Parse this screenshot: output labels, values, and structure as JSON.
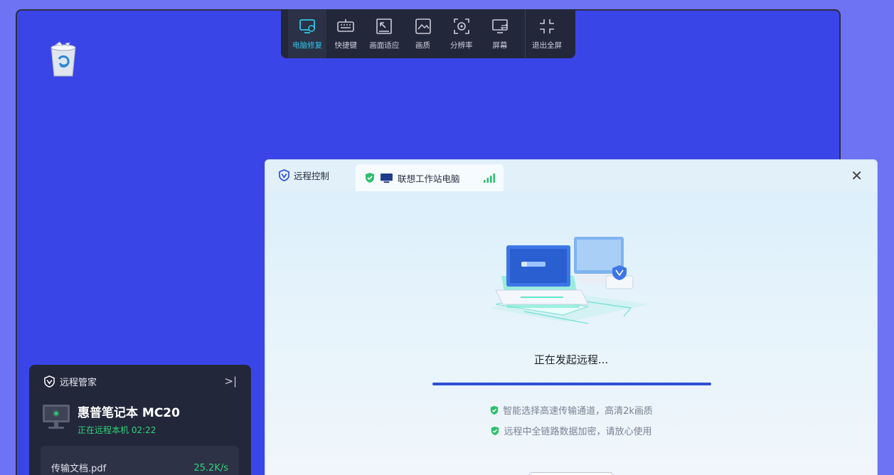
{
  "toolbar": {
    "items": [
      {
        "label": "电脑修复",
        "icon": "monitor-repair-icon",
        "active": true
      },
      {
        "label": "快捷键",
        "icon": "keyboard-icon"
      },
      {
        "label": "画面适应",
        "icon": "fit-screen-icon"
      },
      {
        "label": "画质",
        "icon": "image-quality-icon"
      },
      {
        "label": "分辨率",
        "icon": "resolution-icon"
      },
      {
        "label": "屏幕",
        "icon": "screen-switch-icon"
      },
      {
        "label": "退出全屏",
        "icon": "exit-fullscreen-icon"
      }
    ]
  },
  "manager": {
    "title": "远程管家",
    "device_name": "惠普笔记本 MC20",
    "status": "正在远程本机 02:22",
    "file_name": "传输文档.pdf",
    "file_speed": "25.2K/s"
  },
  "dialog": {
    "brand": "远程控制",
    "tab_label": "联想工作站电脑",
    "status": "正在发起远程...",
    "progress": 1.0,
    "features": [
      "智能选择高速传输通道，高清2k画质",
      "远程中全链路数据加密，请放心使用"
    ]
  },
  "colors": {
    "desktop_bg": "#3a45e8",
    "accent_cyan": "#2fc6e8",
    "accent_green": "#2fd37c",
    "progress_blue": "#2f50d6"
  }
}
